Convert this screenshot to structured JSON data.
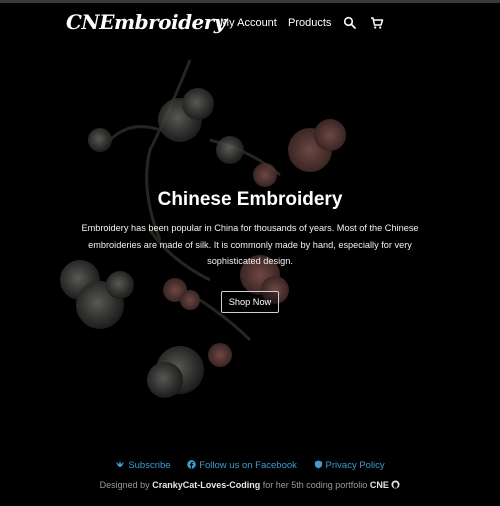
{
  "colors": {
    "background": "#000000",
    "link": "#3e9bd2",
    "muted_text": "#9a9a9a"
  },
  "navbar": {
    "brand": "CNEmbroidery",
    "links": [
      "My Account",
      "Products"
    ],
    "icons": [
      "search-icon",
      "cart-icon"
    ]
  },
  "hero": {
    "title": "Chinese Embroidery",
    "description": "Embroidery has been popular in China for thousands of years. Most of the Chinese embroideries are made of silk. It is commonly made by hand, especially for very sophisticated design.",
    "button": "Shop Now"
  },
  "footer": {
    "links": [
      {
        "label": "Subscribe",
        "icon": "bird-icon"
      },
      {
        "label": "Follow us on Facebook",
        "icon": "facebook-icon"
      },
      {
        "label": "Privacy Policy",
        "icon": "shield-icon"
      }
    ],
    "credit_prefix": "Designed by",
    "credit_author": "CrankyCat-Loves-Coding",
    "credit_middle": "for her 5th coding portfolio",
    "credit_project": "CNE",
    "credit_icon": "github-icon"
  }
}
